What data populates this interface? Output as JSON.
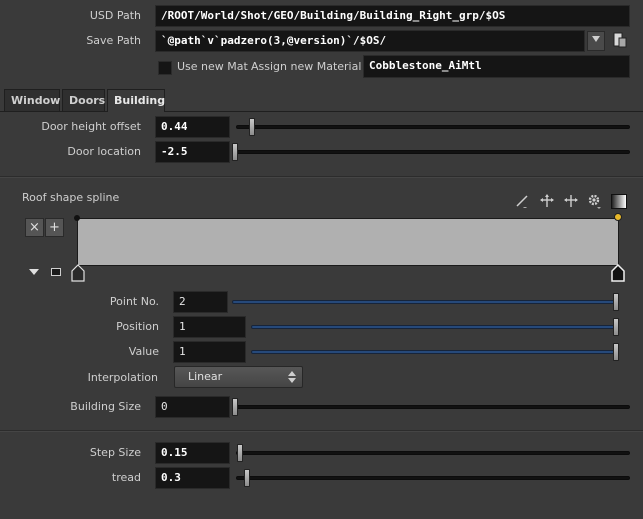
{
  "header": {
    "usd_path_label": "USD Path",
    "usd_path_value": "/ROOT/World/Shot/GEO/Building/Building_Right_grp/$OS",
    "save_path_label": "Save Path",
    "save_path_value": "`@path`v`padzero(3,@version)`/$OS/",
    "use_new_mat_label": "Use new Mat",
    "use_new_mat_checked": false,
    "assign_material_label": "Assign new Material",
    "assign_material_value": "Cobblestone_AiMtl"
  },
  "tabs": [
    {
      "label": "Window",
      "active": false
    },
    {
      "label": "Doors",
      "active": false
    },
    {
      "label": "Building",
      "active": true
    }
  ],
  "doors": {
    "height_label": "Door height offset",
    "height_value": "0.44",
    "location_label": "Door location",
    "location_value": "-2.5"
  },
  "spline": {
    "title": "Roof shape spline",
    "remove_symbol": "×",
    "add_symbol": "+",
    "point_no_label": "Point No.",
    "point_no_value": "2",
    "position_label": "Position",
    "position_value": "1",
    "value_label": "Value",
    "value_value": "1",
    "interpolation_label": "Interpolation",
    "interpolation_value": "Linear",
    "ramp_color": "#b0b0b0",
    "point_color": "#e8b82a"
  },
  "building": {
    "size_label": "Building Size",
    "size_value": "0",
    "step_label": "Step Size",
    "step_value": "0.15",
    "tread_label": "tread",
    "tread_value": "0.3"
  }
}
